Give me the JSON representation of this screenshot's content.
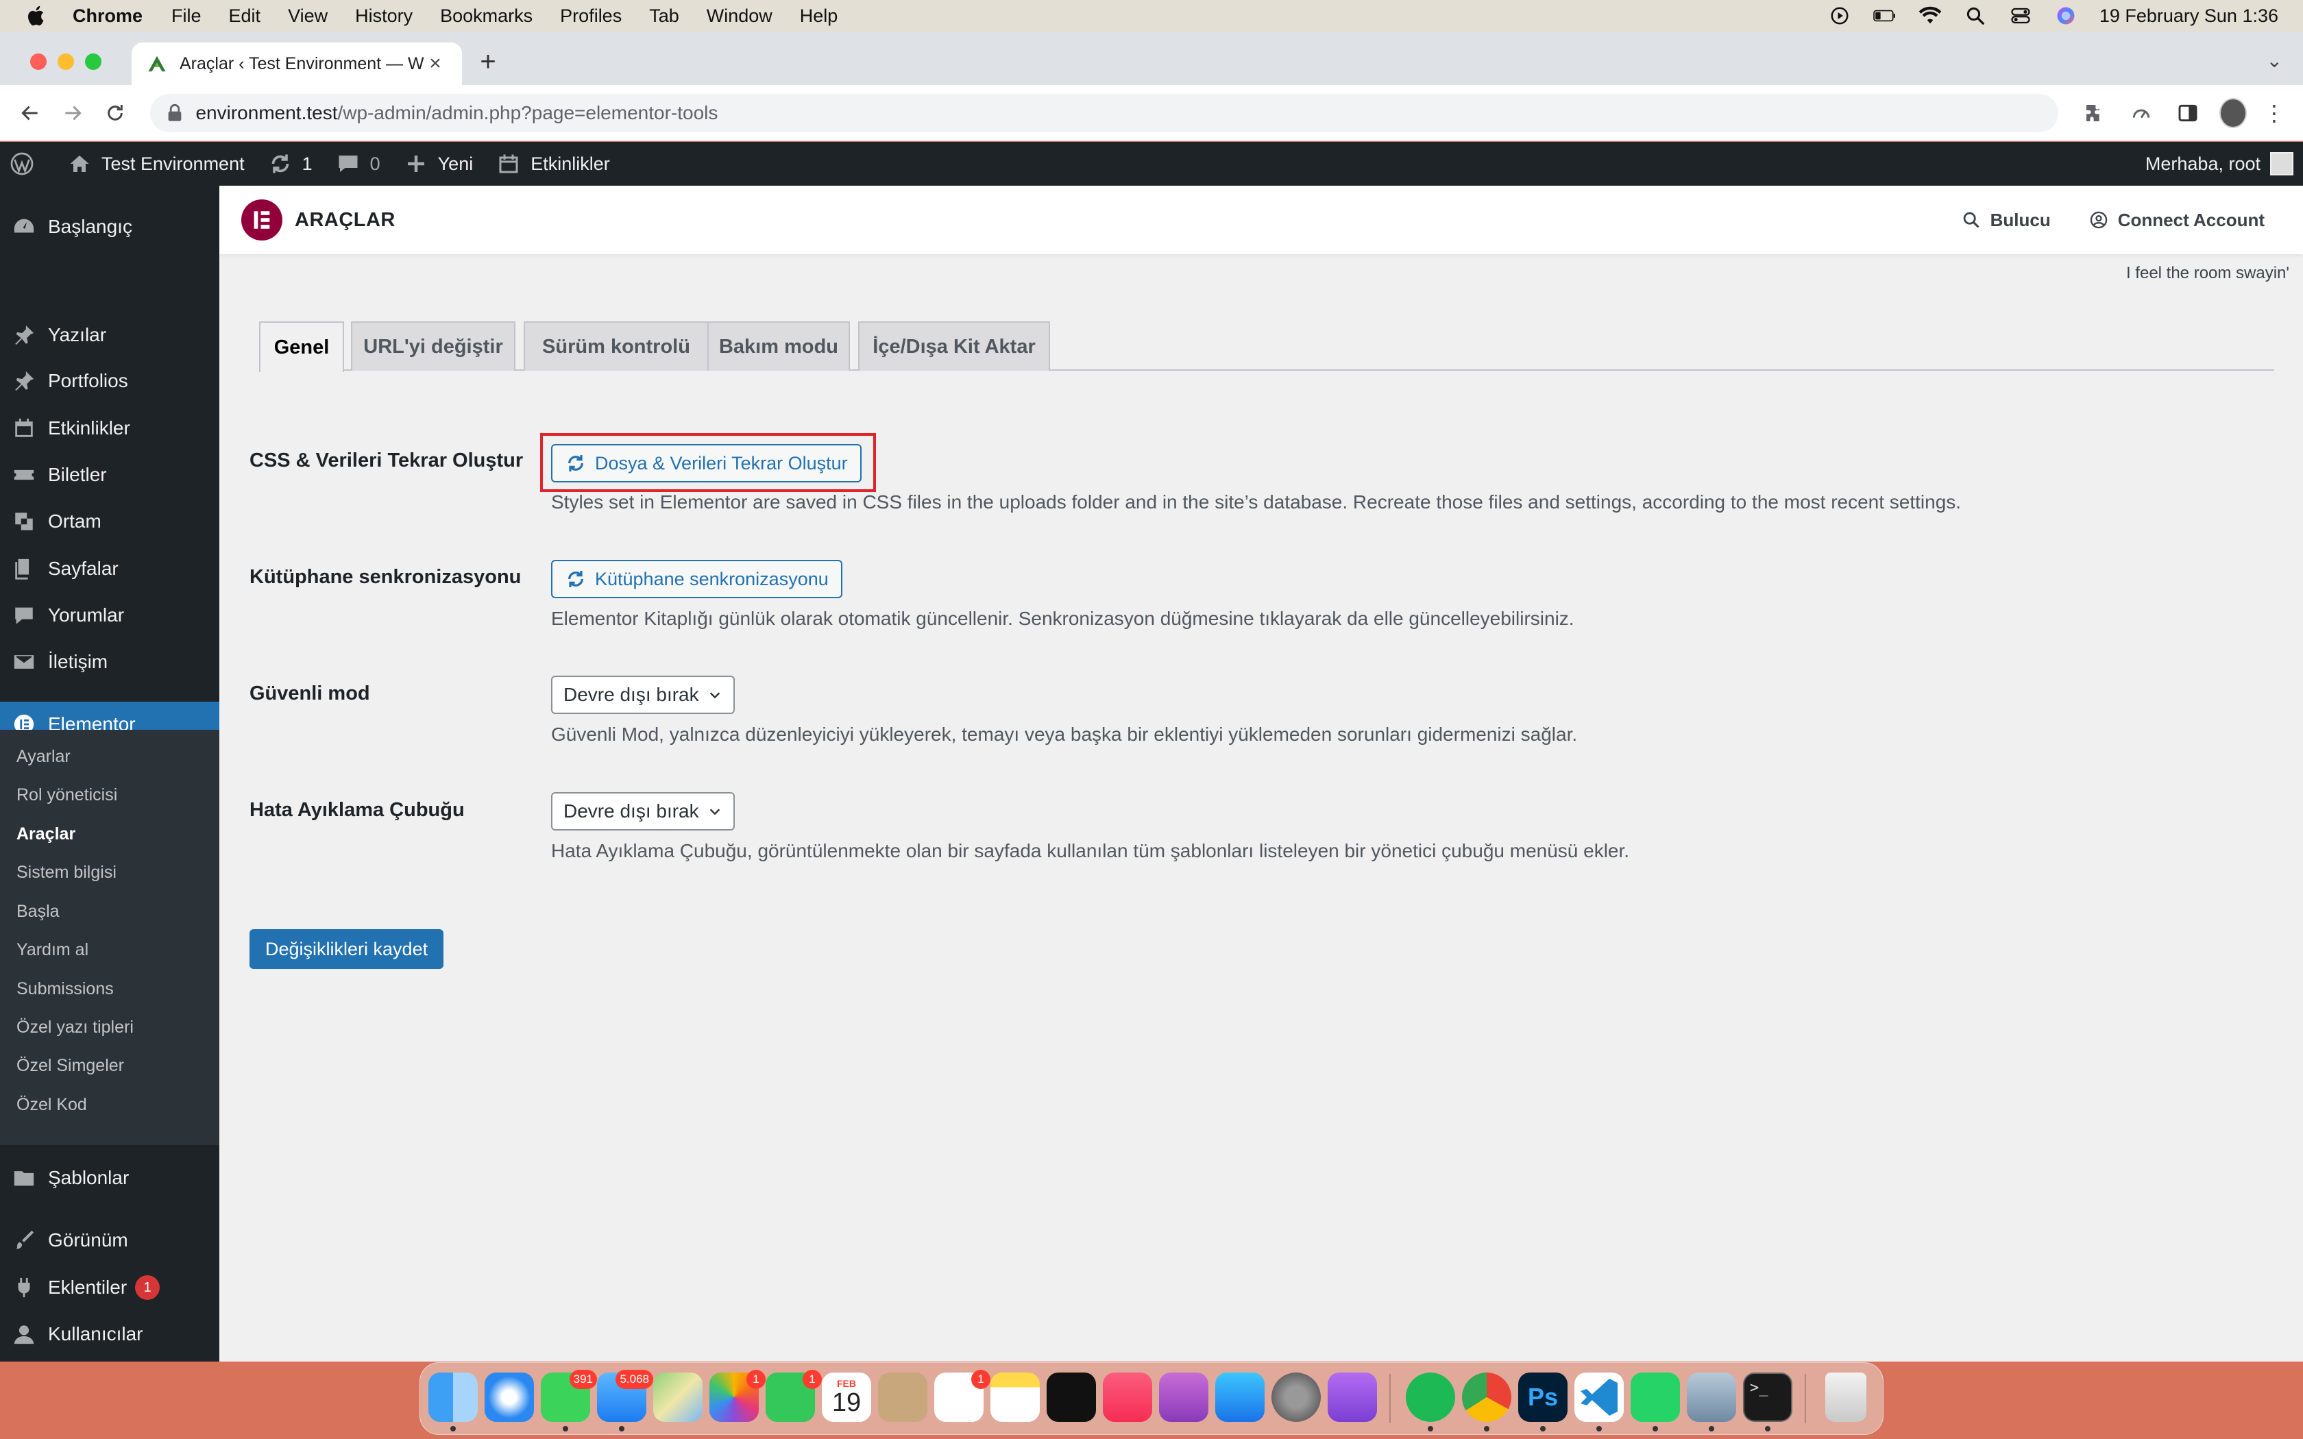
{
  "menubar": {
    "app_name": "Chrome",
    "items": [
      "File",
      "Edit",
      "View",
      "History",
      "Bookmarks",
      "Profiles",
      "Tab",
      "Window",
      "Help"
    ],
    "datetime": "19 February Sun  1:36"
  },
  "browser": {
    "tab_title": "Araçlar ‹ Test Environment — W",
    "url_host": "environment.test",
    "url_path": "/wp-admin/admin.php?page=elementor-tools"
  },
  "adminbar": {
    "site_name": "Test Environment",
    "updates_count": "1",
    "comments_count": "0",
    "new_label": "Yeni",
    "events_label": "Etkinlikler",
    "greeting": "Merhaba, root"
  },
  "sidebar": {
    "items": [
      {
        "label": "Başlangıç",
        "icon": "dashboard-icon"
      },
      {
        "label": "Yazılar",
        "icon": "pin-icon"
      },
      {
        "label": "Portfolios",
        "icon": "pin-icon"
      },
      {
        "label": "Etkinlikler",
        "icon": "calendar-icon"
      },
      {
        "label": "Biletler",
        "icon": "ticket-icon"
      },
      {
        "label": "Ortam",
        "icon": "media-icon"
      },
      {
        "label": "Sayfalar",
        "icon": "pages-icon"
      },
      {
        "label": "Yorumlar",
        "icon": "comment-icon"
      },
      {
        "label": "İletişim",
        "icon": "mail-icon"
      },
      {
        "label": "Elementor",
        "icon": "elementor-icon"
      },
      {
        "label": "Şablonlar",
        "icon": "folder-icon"
      },
      {
        "label": "Görünüm",
        "icon": "brush-icon"
      },
      {
        "label": "Eklentiler",
        "icon": "plugin-icon",
        "badge": "1"
      },
      {
        "label": "Kullanıcılar",
        "icon": "user-icon"
      }
    ],
    "submenu": [
      "Ayarlar",
      "Rol yöneticisi",
      "Araçlar",
      "Sistem bilgisi",
      "Başla",
      "Yardım al",
      "Submissions",
      "Özel yazı tipleri",
      "Özel Simgeler",
      "Özel Kod"
    ]
  },
  "header": {
    "title": "ARAÇLAR",
    "finder_label": "Bulucu",
    "connect_label": "Connect Account",
    "hello_dolly": "I feel the room swayin'"
  },
  "tabs": [
    "Genel",
    "URL'yi değiştir",
    "Sürüm kontrolü",
    "Bakım modu",
    "İçe/Dışa Kit Aktar"
  ],
  "settings": {
    "regenerate": {
      "label": "CSS & Verileri Tekrar Oluştur",
      "button": "Dosya & Verileri Tekrar Oluştur",
      "description": "Styles set in Elementor are saved in CSS files in the uploads folder and in the site’s database. Recreate those files and settings, according to the most recent settings."
    },
    "library_sync": {
      "label": "Kütüphane senkronizasyonu",
      "button": "Kütüphane senkronizasyonu",
      "description": "Elementor Kitaplığı günlük olarak otomatik güncellenir. Senkronizasyon düğmesine tıklayarak da elle güncelleyebilirsiniz."
    },
    "safe_mode": {
      "label": "Güvenli mod",
      "selected": "Devre dışı bırak",
      "description": "Güvenli Mod, yalnızca düzenleyiciyi yükleyerek, temayı veya başka bir eklentiyi yüklemeden sorunları gidermenizi sağlar."
    },
    "debug_bar": {
      "label": "Hata Ayıklama Çubuğu",
      "selected": "Devre dışı bırak",
      "description": "Hata Ayıklama Çubuğu, görüntülenmekte olan bir sayfada kullanılan tüm şablonları listeleyen bir yönetici çubuğu menüsü ekler."
    },
    "save_label": "Değişiklikleri kaydet"
  },
  "dock": {
    "badges": {
      "messages": "391",
      "mail": "5.068",
      "photos": "1",
      "facetime": "1",
      "reminders": "1"
    },
    "calendar_month": "FEB",
    "calendar_day": "19",
    "apps": [
      "finder",
      "safari",
      "messages",
      "mail",
      "maps",
      "photos",
      "facetime",
      "calendar",
      "contacts",
      "reminders",
      "notes",
      "tv",
      "music",
      "podcasts",
      "app-store",
      "system-preferences",
      "feedback",
      "spotify",
      "chrome",
      "photoshop",
      "vscode",
      "whatsapp",
      "preview",
      "terminal",
      "trash"
    ]
  },
  "colors": {
    "wp_admin_dark": "#1d2327",
    "wp_blue": "#2271b1",
    "elementor_brand": "#92003b",
    "highlight_red": "#e0242b"
  }
}
